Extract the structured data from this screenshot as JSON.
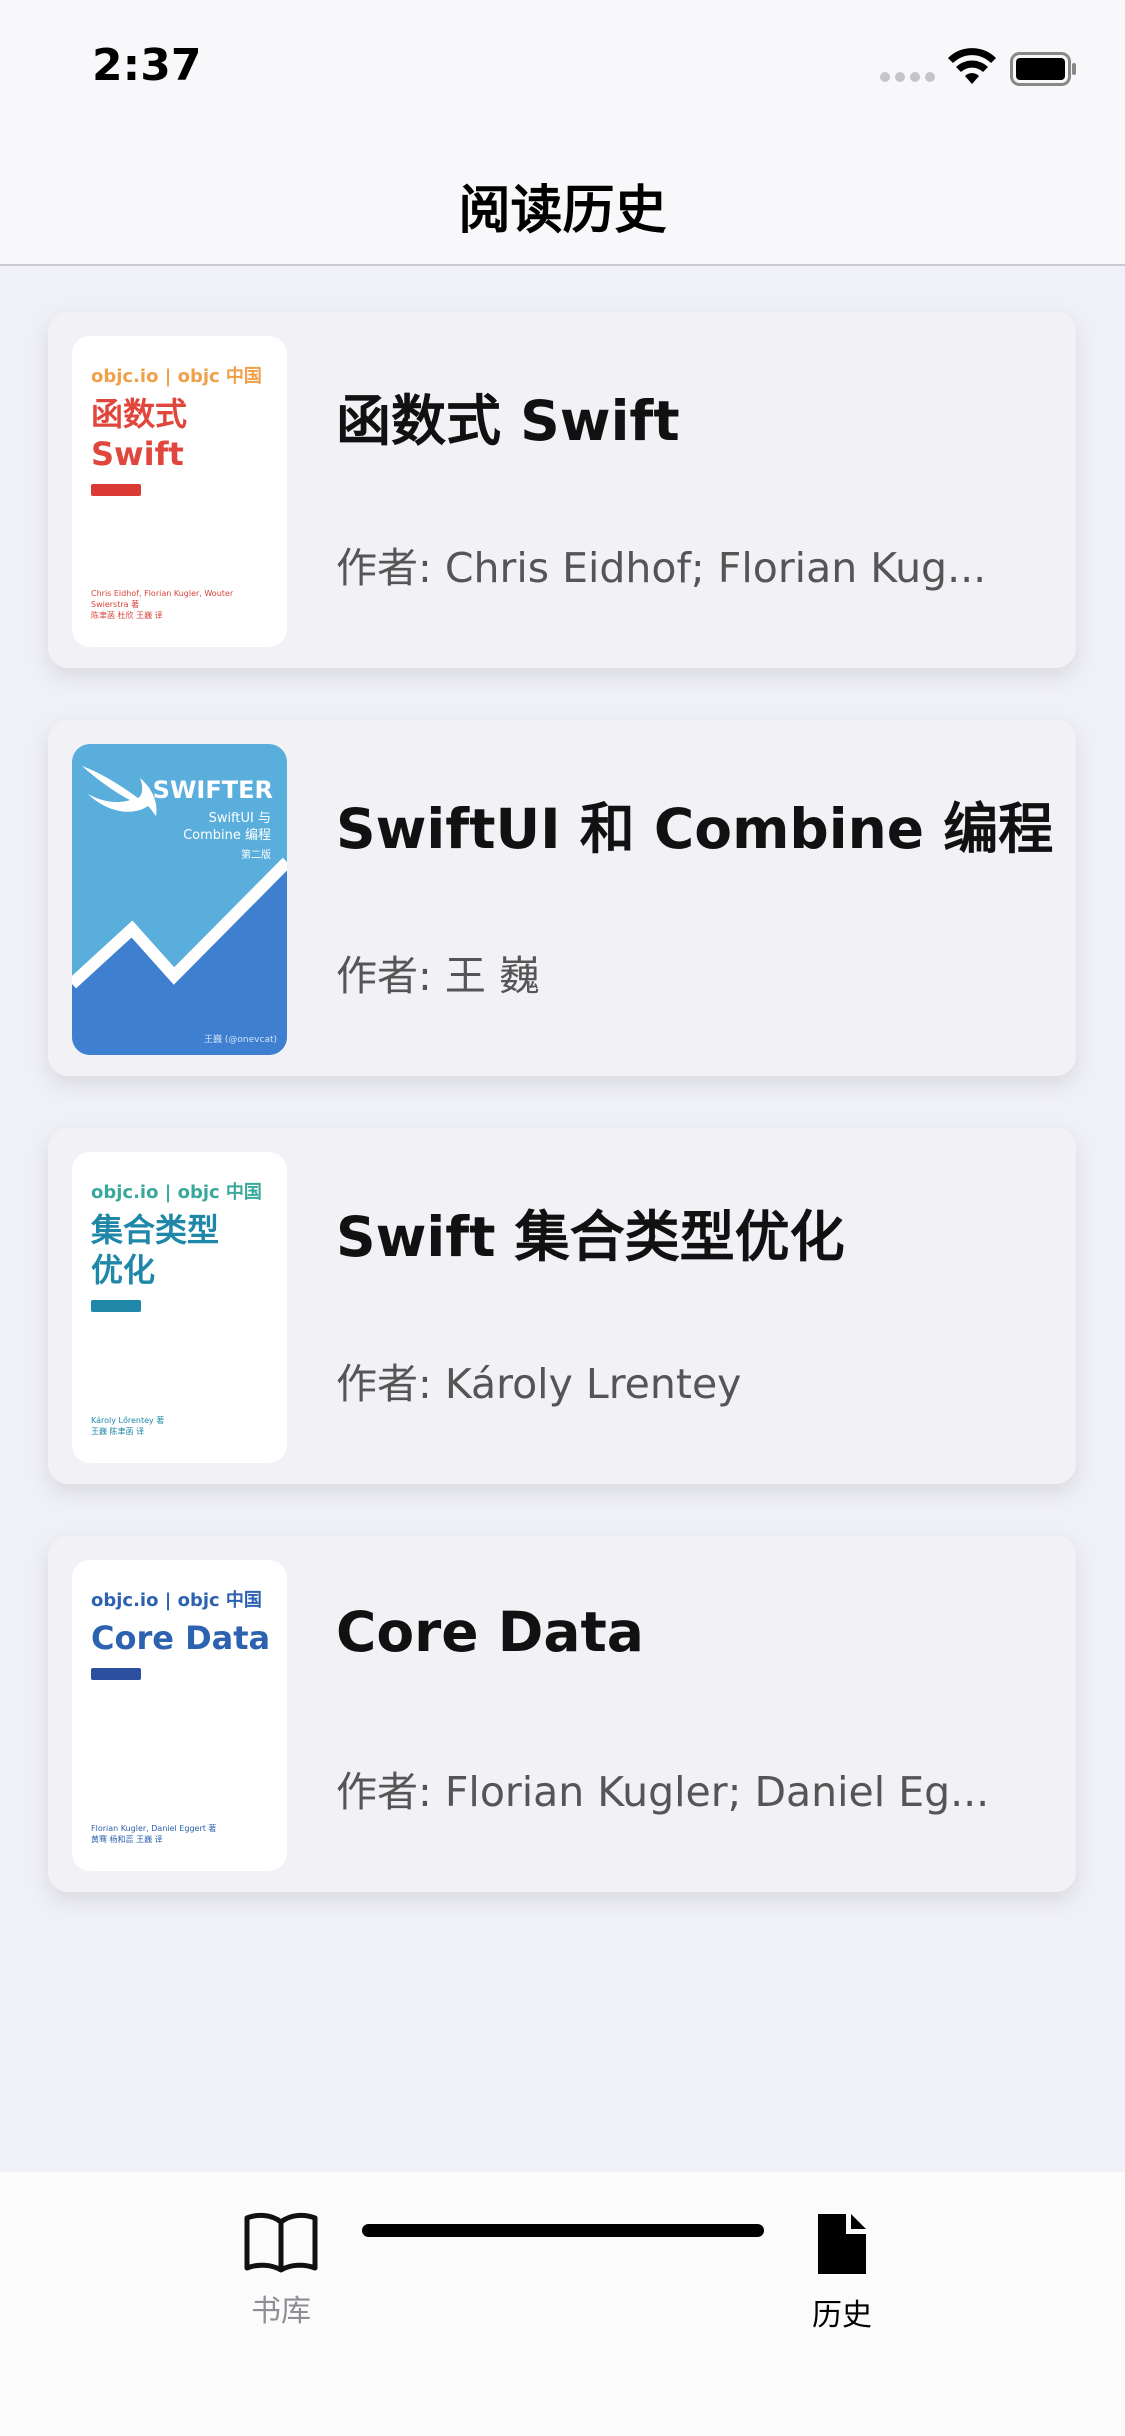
{
  "status": {
    "time": "2:37"
  },
  "nav": {
    "title": "阅读历史"
  },
  "books": [
    {
      "title": "函数式 Swift",
      "author": "作者: Chris Eidhof; Florian Kug...",
      "cover": {
        "brand": "objc.io | objc 中国",
        "title": "函数式\nSwift",
        "authors": "Chris Eidhof, Florian Kugler, Wouter Swierstra 著\n陈聿菡 杜欣 王巍 译",
        "brand_color": "#f0a04a",
        "title_color": "#e0463c",
        "tag_color": "#d93a33"
      }
    },
    {
      "title": "SwiftUI 和 Combine 编程",
      "author": "作者: 王 巍",
      "cover": {
        "brand": "SWIFTER",
        "subtitle": "SwiftUI 与\nCombine 编程",
        "edition": "第二版",
        "footer": "王巍 (@onevcat)",
        "bg_color": "#5aaedc",
        "accent_color": "#3f7fd0"
      }
    },
    {
      "title": "Swift 集合类型优化",
      "author": "作者: Károly Lrentey",
      "cover": {
        "brand": "objc.io | objc 中国",
        "title": "集合类型\n优化",
        "authors": "Károly Lőrentey 著\n王巍 陈聿菡 译",
        "brand_color": "#3aa89a",
        "title_color": "#1f87a8",
        "tag_color": "#1f87a8"
      }
    },
    {
      "title": "Core Data",
      "author": "作者: Florian Kugler; Daniel Eg...",
      "cover": {
        "brand": "objc.io | objc 中国",
        "title": "Core Data",
        "authors": "Florian Kugler, Daniel Eggert 著\n黄骞 杨和蕊 王巍 译",
        "brand_color": "#2d62b0",
        "title_color": "#2d62b0",
        "tag_color": "#2d4fa0"
      }
    }
  ],
  "tabs": [
    {
      "label": "书库",
      "icon": "book-icon",
      "selected": false,
      "color": "#8e8e93"
    },
    {
      "label": "历史",
      "icon": "document-icon",
      "selected": true,
      "color": "#000000"
    }
  ]
}
